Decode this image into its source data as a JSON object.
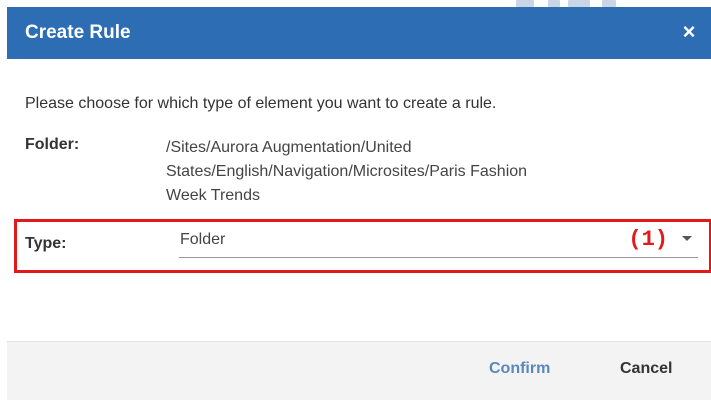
{
  "dialog": {
    "title": "Create Rule",
    "close_icon": "×",
    "intro": "Please choose for which type of element you want to create a rule.",
    "folder": {
      "label": "Folder:",
      "value_lines": [
        "/Sites/Aurora Augmentation/United",
        "States/English/Navigation/Microsites/Paris Fashion",
        "Week Trends"
      ]
    },
    "type": {
      "label": "Type:",
      "value": "Folder",
      "annotation": "(1)"
    },
    "buttons": {
      "confirm": "Confirm",
      "cancel": "Cancel"
    }
  },
  "colors": {
    "header": "#2d6db4",
    "highlight": "#e01a1a",
    "confirm": "#5b87bb"
  },
  "icons": {
    "close": "close-icon",
    "dropdown": "caret-down-icon"
  }
}
